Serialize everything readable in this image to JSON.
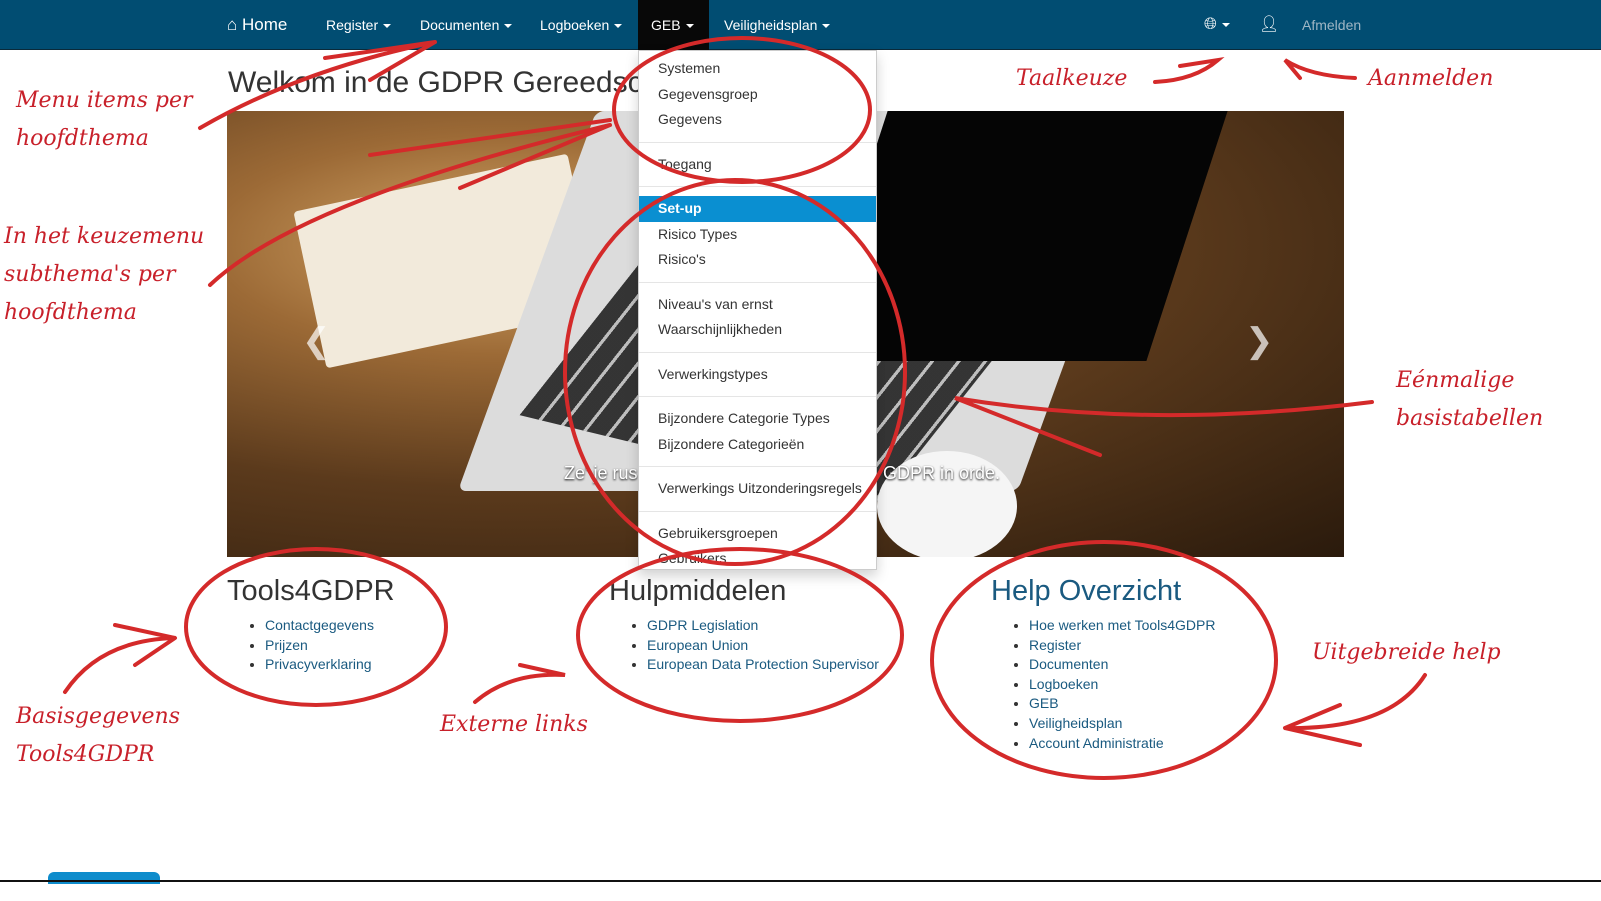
{
  "nav": {
    "home": "Home",
    "items": [
      "Register",
      "Documenten",
      "Logboeken",
      "GEB",
      "Veiligheidsplan"
    ],
    "active": "GEB",
    "logout": "Afmelden"
  },
  "title": "Welkom in de GDPR Gereedsch",
  "carousel": {
    "caption_left": "Ze' je rus",
    "caption_right": "GDPR in orde."
  },
  "dropdown": {
    "groups": [
      [
        "Systemen",
        "Gegevensgroep",
        "Gegevens"
      ],
      [
        "Toegang"
      ],
      [
        "Set-up",
        "Risico Types",
        "Risico's"
      ],
      [
        "Niveau's van ernst",
        "Waarschijnlijkheden"
      ],
      [
        "Verwerkingstypes"
      ],
      [
        "Bijzondere Categorie Types",
        "Bijzondere Categorieën"
      ],
      [
        "Verwerkings Uitzonderingsregels"
      ],
      [
        "Gebruikersgroepen",
        "Gebruikers"
      ]
    ],
    "selected": "Set-up"
  },
  "columns": [
    {
      "title": "Tools4GDPR",
      "links": [
        "Contactgegevens",
        "Prijzen",
        "Privacyverklaring"
      ]
    },
    {
      "title": "Hulpmiddelen",
      "links": [
        "GDPR Legislation",
        "European Union",
        "European Data Protection Supervisor"
      ]
    },
    {
      "title": "Help Overzicht",
      "links": [
        "Hoe werken met Tools4GDPR",
        "Register",
        "Documenten",
        "Logboeken",
        "GEB",
        "Veiligheidsplan",
        "Account Administratie"
      ]
    }
  ],
  "annotations": {
    "menu": [
      "Menu items per",
      "hoofdthema"
    ],
    "keuze": [
      "In het keuzemenu",
      "subthema's per",
      "hoofdthema"
    ],
    "taal": "Taalkeuze",
    "aanmelden": "Aanmelden",
    "eenmalig": [
      "Eénmalige",
      "basistabellen"
    ],
    "basis": [
      "Basisgegevens",
      "Tools4GDPR"
    ],
    "extern": "Externe links",
    "help": "Uitgebreide help"
  },
  "colors": {
    "navbar": "#014d72",
    "selected": "#0a8fd1",
    "annotation": "#c8202a",
    "link": "#1a5a80"
  }
}
